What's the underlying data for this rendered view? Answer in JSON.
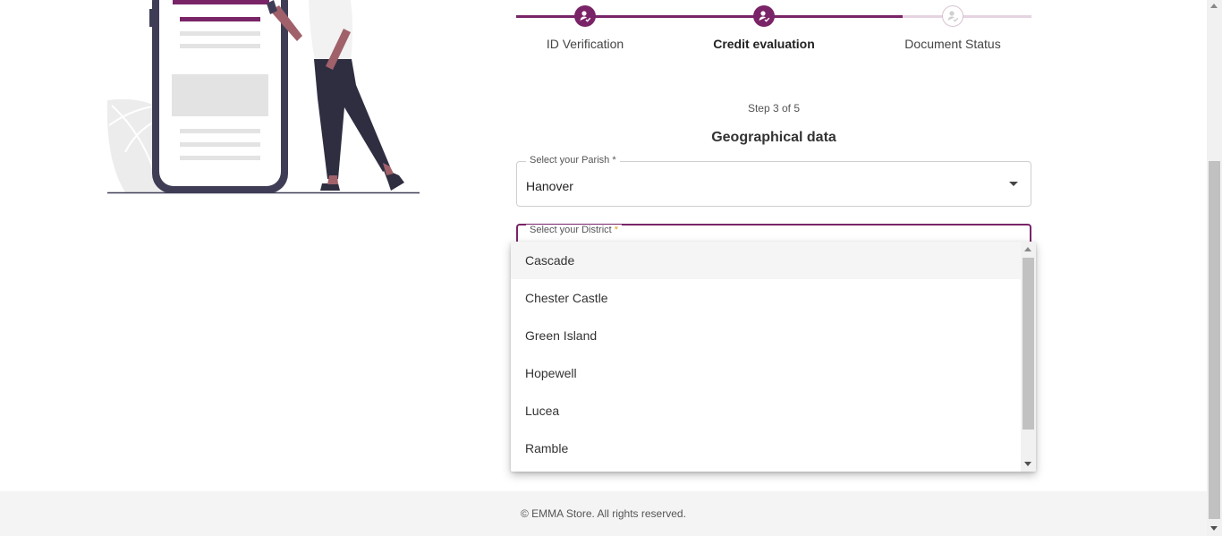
{
  "stepper": {
    "steps": [
      {
        "label": "ID Verification",
        "state": "done"
      },
      {
        "label": "Credit evaluation",
        "state": "active"
      },
      {
        "label": "Document Status",
        "state": "pending"
      }
    ]
  },
  "form": {
    "step_counter": "Step 3 of 5",
    "section_title": "Geographical data",
    "parish": {
      "label": "Select your Parish",
      "required_mark": "*",
      "value": "Hanover"
    },
    "district": {
      "label": "Select your District",
      "required_mark": "*"
    }
  },
  "district_dropdown": {
    "options": [
      "Cascade",
      "Chester Castle",
      "Green Island",
      "Hopewell",
      "Lucea",
      "Ramble"
    ],
    "highlighted": "Cascade"
  },
  "footer": {
    "copyright": "© EMMA Store. All rights reserved."
  },
  "colors": {
    "accent": "#7a2468",
    "accent_light": "#d8c3d3",
    "footer_bg": "#f4f4f4",
    "required_star": "#e0a020"
  }
}
